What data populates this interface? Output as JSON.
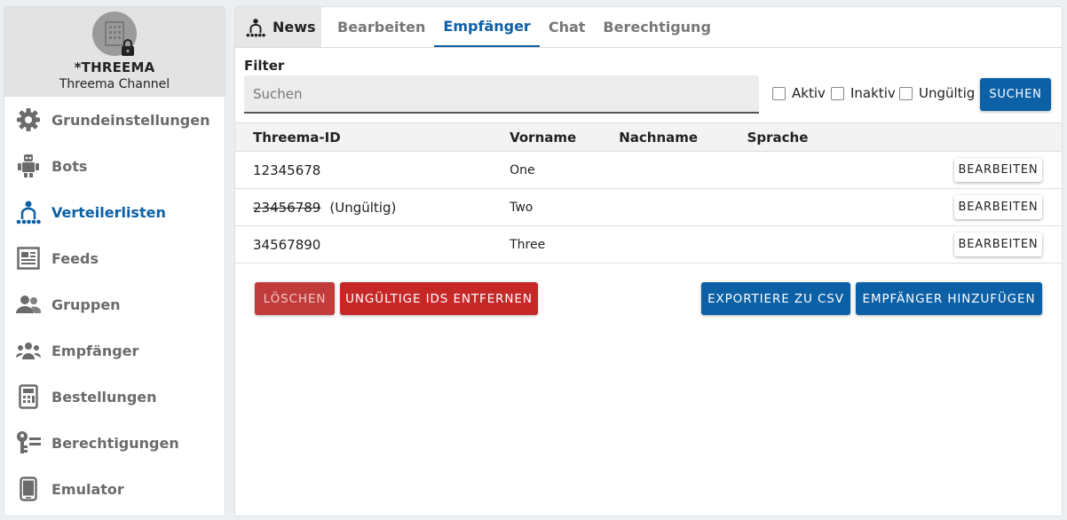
{
  "sidebar": {
    "title": "*THREEMA",
    "subtitle": "Threema Channel",
    "items": [
      {
        "label": "Grundeinstellungen",
        "icon": "gear-icon"
      },
      {
        "label": "Bots",
        "icon": "robot-icon"
      },
      {
        "label": "Verteilerlisten",
        "icon": "distribution-list-icon",
        "active": true
      },
      {
        "label": "Feeds",
        "icon": "feed-icon"
      },
      {
        "label": "Gruppen",
        "icon": "group-icon"
      },
      {
        "label": "Empfänger",
        "icon": "recipients-icon"
      },
      {
        "label": "Bestellungen",
        "icon": "calculator-icon"
      },
      {
        "label": "Berechtigungen",
        "icon": "key-list-icon"
      },
      {
        "label": "Emulator",
        "icon": "phone-icon"
      }
    ]
  },
  "tabs": {
    "main_label": "News",
    "items": [
      "Bearbeiten",
      "Empfänger",
      "Chat",
      "Berechtigung"
    ],
    "active": "Empfänger"
  },
  "filter": {
    "label": "Filter",
    "search_placeholder": "Suchen",
    "checkboxes": [
      "Aktiv",
      "Inaktiv",
      "Ungültig"
    ],
    "search_button": "SUCHEN"
  },
  "table": {
    "headers": [
      "Threema-ID",
      "Vorname",
      "Nachname",
      "Sprache"
    ],
    "rows": [
      {
        "id": "12345678",
        "invalid_hint": "",
        "firstname": "One",
        "lastname": "",
        "language": "",
        "action": "BEARBEITEN"
      },
      {
        "id": "23456789",
        "invalid_hint": "(Ungültig)",
        "firstname": "Two",
        "lastname": "",
        "language": "",
        "action": "BEARBEITEN"
      },
      {
        "id": "34567890",
        "invalid_hint": "",
        "firstname": "Three",
        "lastname": "",
        "language": "",
        "action": "BEARBEITEN"
      }
    ]
  },
  "actions": {
    "delete": "LÖSCHEN",
    "remove_invalid": "UNGÜLTIGE IDS ENTFERNEN",
    "export_csv": "EXPORTIERE ZU CSV",
    "add_recipient": "EMPFÄNGER HINZUFÜGEN"
  },
  "colors": {
    "accent": "#0c60a6",
    "danger": "#c62828",
    "muted_text": "#6b6b6b"
  }
}
